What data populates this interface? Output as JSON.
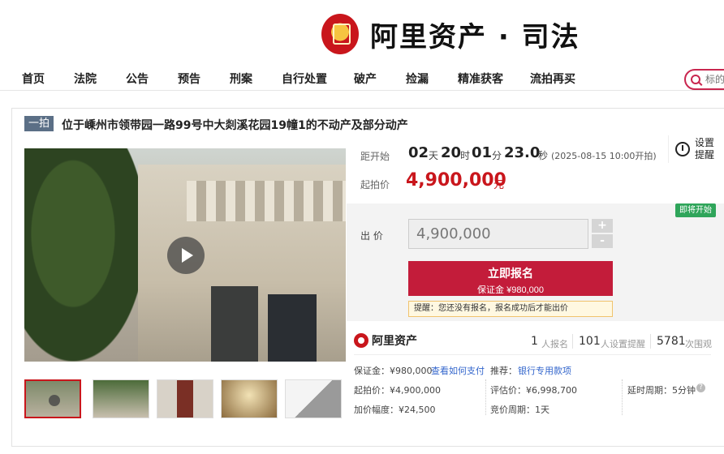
{
  "header": {
    "brand": "阿里资产 · 司法"
  },
  "nav": {
    "items": [
      "首页",
      "法院",
      "公告",
      "预告",
      "刑案",
      "自行处置",
      "破产",
      "捡漏",
      "精准获客",
      "流拍再买"
    ],
    "search_placeholder": "标的"
  },
  "lot": {
    "badge": "一拍",
    "title": "位于嵊州市领带园一路99号中大剡溪花园19幢1的不动产及部分动产"
  },
  "countdown": {
    "label": "距开始",
    "days": "02",
    "days_unit": "天",
    "hours": "20",
    "hours_unit": "时",
    "minutes": "01",
    "minutes_unit": "分",
    "seconds": "23.0",
    "seconds_unit": "秒",
    "start_time": "(2025-08-15 10:00开拍)"
  },
  "remind": {
    "label": "设置提醒"
  },
  "price": {
    "label": "起拍价",
    "value": "4,900,000",
    "unit": "元"
  },
  "bid": {
    "status_badge": "即将开始",
    "label": "出 价",
    "value": "4,900,000",
    "plus": "+",
    "minus": "-",
    "signup_label": "立即报名",
    "deposit_label": "保证金 ¥980,000",
    "tip": "提醒：您还没有报名，报名成功后才能出价"
  },
  "stats": {
    "logo_text": "阿里资产",
    "signups": "1",
    "signups_label": "人报名",
    "reminders": "101",
    "reminders_label": "人设置提醒",
    "views": "5781",
    "views_label": "次围观"
  },
  "details": {
    "deposit": "保证金：¥980,000",
    "how_to_pay": "查看如何支付",
    "recommend_label": "推荐：",
    "recommend_link": "银行专用款项",
    "start_price": "起拍价：¥4,900,000",
    "appraisal": "评估价：¥6,998,700",
    "delay": "延时周期：5分钟",
    "increment": "加价幅度：¥24,500",
    "bid_cycle": "竞价周期：1天",
    "help_icon": "?"
  }
}
